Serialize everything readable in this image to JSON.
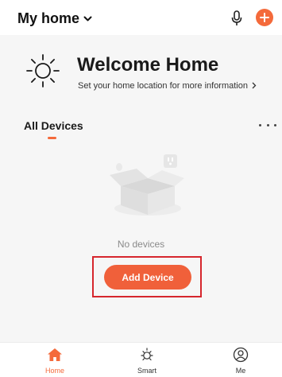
{
  "header": {
    "home_label": "My home"
  },
  "welcome": {
    "title": "Welcome Home",
    "subtitle": "Set your home location for more information"
  },
  "devices": {
    "tab_label": "All Devices",
    "empty_text": "No devices",
    "add_button_label": "Add Device"
  },
  "tabs": [
    {
      "label": "Home",
      "icon": "home-icon",
      "active": true
    },
    {
      "label": "Smart",
      "icon": "sun-icon",
      "active": false
    },
    {
      "label": "Me",
      "icon": "user-icon",
      "active": false
    }
  ],
  "colors": {
    "accent": "#f46a3b",
    "highlight_box": "#d6262d",
    "background": "#f6f6f6"
  }
}
